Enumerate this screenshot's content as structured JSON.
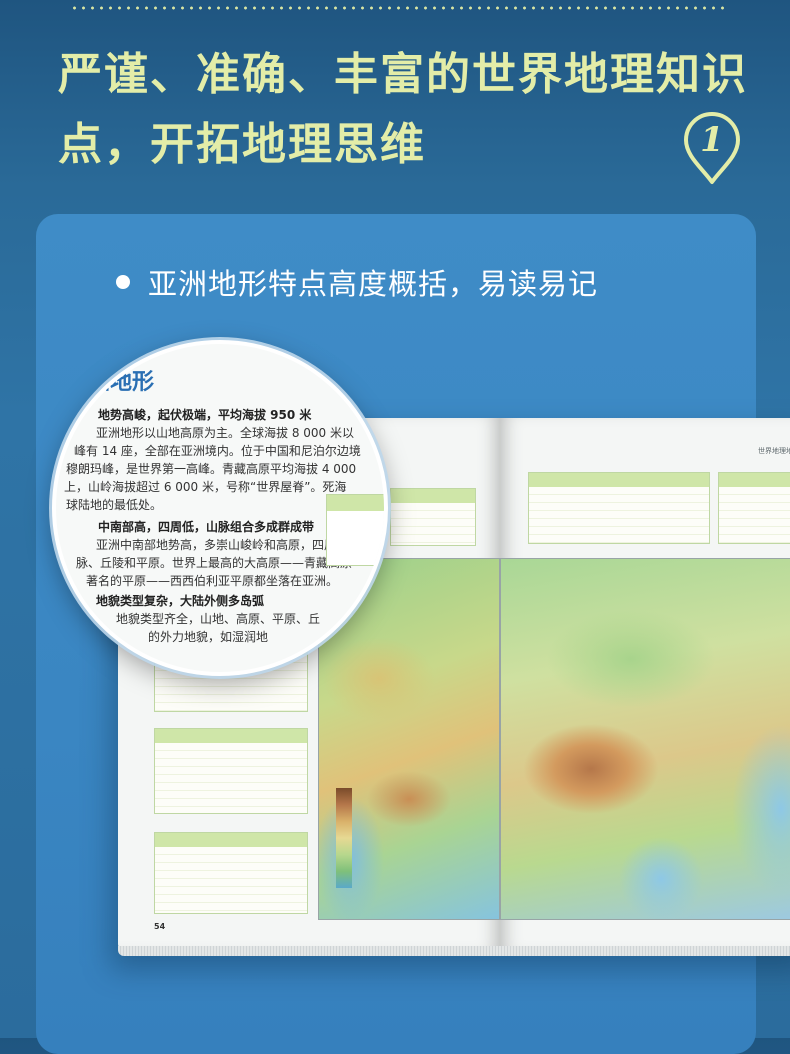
{
  "header": {
    "line1": "严谨、准确、丰富的世界地理知识",
    "line2": "点，开拓地理思维",
    "badge_number": "1"
  },
  "feature": {
    "bullet": "亚洲地形特点高度概括，易读易记"
  },
  "book": {
    "right_page_title": "世界地理地",
    "page_number": "54"
  },
  "magnifier": {
    "title": "洲地形",
    "heading1": "地势高峻，起伏极端，平均海拔 950 米",
    "p1": [
      "亚洲地形以山地高原为主。全球海拔 8 000 米以",
      "峰有 14 座，全部在亚洲境内。位于中国和尼泊尔边境",
      "穆朗玛峰，是世界第一高峰。青藏高原平均海拔 4 000",
      "上，山岭海拔超过 6 000 米，号称“世界屋脊”。死海",
      "球陆地的最低处。"
    ],
    "heading2": "中南部高，四周低，山脉组合多成群成带",
    "p2": [
      "亚洲中南部地势高，多崇山峻岭和高原，四周多",
      "脉、丘陵和平原。世界上最高的大高原——青藏高原",
      "著名的平原——西西伯利亚平原都坐落在亚洲。"
    ],
    "heading3": "地貌类型复杂，大陆外侧多岛弧",
    "p3": [
      "地貌类型齐全，山地、高原、平原、丘",
      "的外力地貌，如湿润地"
    ]
  },
  "colors": {
    "headline": "#e3eda8",
    "card": "#3f8cc7",
    "magnifier_title": "#2a6fb3"
  }
}
